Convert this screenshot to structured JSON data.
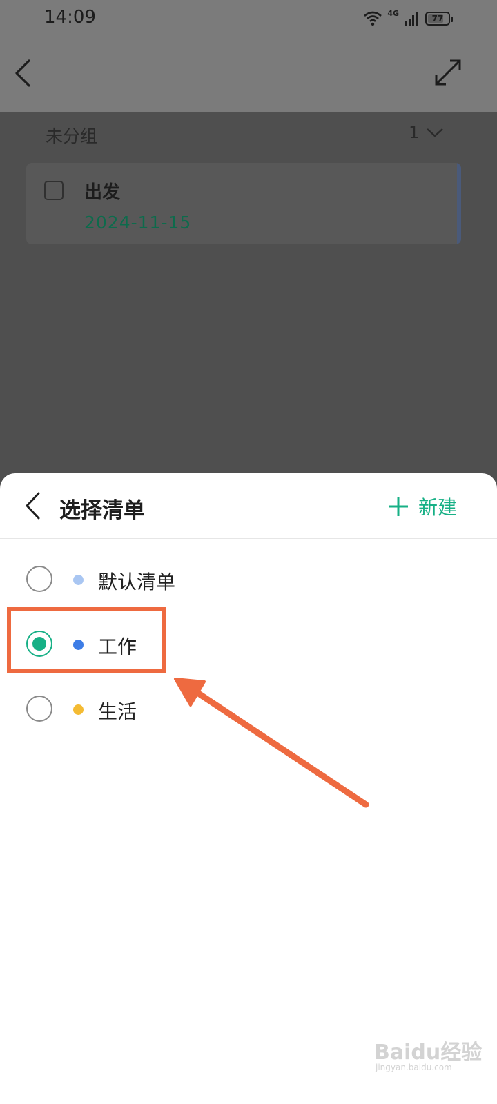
{
  "status_bar": {
    "time": "14:09",
    "network": "4G",
    "battery": "77",
    "icons": [
      "wifi-icon",
      "signal-icon",
      "battery-icon"
    ]
  },
  "top_bar": {
    "icons": [
      "back-arrow-icon",
      "expand-icon"
    ]
  },
  "group": {
    "name": "未分组",
    "count": "1"
  },
  "task": {
    "title": "出发",
    "date": "2024-11-15"
  },
  "sheet": {
    "title": "选择清单",
    "new_label": "新建",
    "items": [
      {
        "label": "默认清单",
        "color": "#a9c6f2",
        "selected": false
      },
      {
        "label": "工作",
        "color": "#3d7de6",
        "selected": true
      },
      {
        "label": "生活",
        "color": "#f4bb33",
        "selected": false
      }
    ]
  },
  "colors": {
    "accent": "#17b086",
    "annotation": "#ee6a40"
  },
  "watermark": {
    "brand": "Baidu经验",
    "url": "jingyan.baidu.com"
  }
}
